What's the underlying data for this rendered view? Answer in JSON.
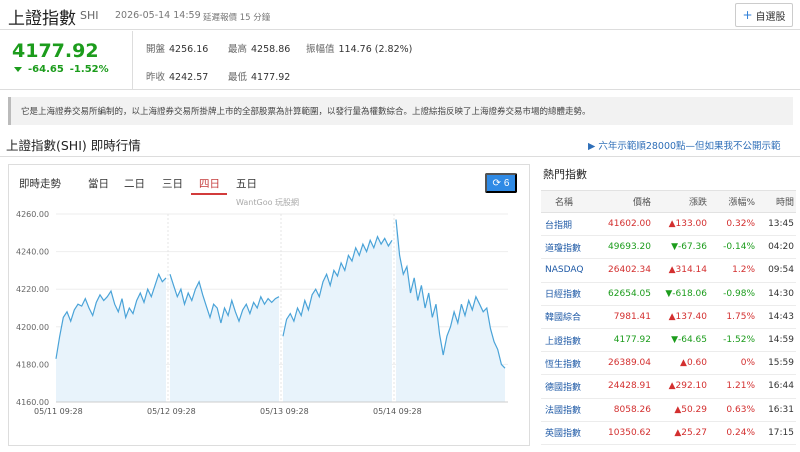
{
  "header": {
    "title": "上證指數",
    "code": "SHI",
    "time": "2026-05-14 14:59",
    "delay_note": "延遲報價 15 分鐘",
    "add_button": "自選股"
  },
  "quote": {
    "price": "4177.92",
    "change": "-64.65",
    "change_pct": "-1.52%",
    "open_label": "開盤",
    "open": "4256.16",
    "high_label": "最高",
    "high": "4258.86",
    "amplitude_label": "振幅值",
    "amplitude": "114.76 (2.82%)",
    "prev_label": "昨收",
    "prev": "4242.57",
    "low_label": "最低",
    "low": "4177.92",
    "colors": {
      "down": "#1c9c1c",
      "up": "#d32f2f"
    }
  },
  "description": "它是上海證券交易所編制的，以上海證券交易所掛牌上市的全部股票為計算範圍，以發行量為權數綜合。上證綜指反映了上海證券交易市場的總體走勢。",
  "section": {
    "title": "上證指數(SHI) 即時行情",
    "news_link": "▶ 六年示範順28000點—但如果我不公開示範"
  },
  "chart_panel": {
    "label": "即時走勢",
    "tabs": [
      "當日",
      "二日",
      "三日",
      "四日",
      "五日"
    ],
    "active_tab": "四日",
    "refresh_label": "6",
    "watermark": "WantGoo 玩股網"
  },
  "chart_data": {
    "type": "line",
    "y_ticks": [
      "4260.00",
      "4240.00",
      "4220.00",
      "4200.00",
      "4180.00",
      "4160.00"
    ],
    "ylim": [
      4160,
      4260
    ],
    "x_labels": [
      "05/11 09:28",
      "05/12 09:28",
      "05/13 09:28",
      "05/14 09:28"
    ],
    "days": [
      {
        "values": [
          4183,
          4195,
          4205,
          4208,
          4203,
          4209,
          4212,
          4211,
          4215,
          4210,
          4206,
          4213,
          4217,
          4214,
          4216,
          4219,
          4212,
          4208,
          4215,
          4205,
          4210,
          4207,
          4214,
          4218,
          4213,
          4220,
          4216,
          4222,
          4228,
          4224,
          4226
        ]
      },
      {
        "values": [
          4228,
          4222,
          4216,
          4220,
          4212,
          4218,
          4214,
          4220,
          4224,
          4217,
          4211,
          4205,
          4212,
          4210,
          4202,
          4210,
          4206,
          4214,
          4208,
          4203,
          4209,
          4212,
          4207,
          4213,
          4210,
          4216,
          4212,
          4215,
          4213,
          4215,
          4216
        ]
      },
      {
        "values": [
          4195,
          4204,
          4207,
          4203,
          4210,
          4206,
          4214,
          4209,
          4217,
          4220,
          4216,
          4224,
          4228,
          4222,
          4230,
          4227,
          4234,
          4230,
          4238,
          4235,
          4242,
          4238,
          4244,
          4240,
          4246,
          4242,
          4248,
          4244,
          4247,
          4243,
          4246
        ]
      },
      {
        "values": [
          4257,
          4238,
          4228,
          4232,
          4218,
          4226,
          4214,
          4222,
          4210,
          4218,
          4205,
          4212,
          4196,
          4185,
          4195,
          4200,
          4208,
          4202,
          4212,
          4206,
          4214,
          4209,
          4216,
          4212,
          4208,
          4210,
          4199,
          4192,
          4188,
          4180,
          4178
        ]
      }
    ],
    "line_color": "#4aa3d8",
    "fill_color": "#e8f3fb",
    "grid": true
  },
  "hot": {
    "title": "熱門指數",
    "headers": [
      "名稱",
      "價格",
      "漲跌",
      "漲幅%",
      "時間"
    ],
    "rows": [
      {
        "name": "台指期",
        "price": "41602.00",
        "chg": "▲133.00",
        "pct": "0.32%",
        "time": "13:45",
        "dir": "up"
      },
      {
        "name": "道瓊指數",
        "price": "49693.20",
        "chg": "▼-67.36",
        "pct": "-0.14%",
        "time": "04:20",
        "dir": "down"
      },
      {
        "name": "NASDAQ",
        "price": "26402.34",
        "chg": "▲314.14",
        "pct": "1.2%",
        "time": "09:54",
        "dir": "up"
      },
      {
        "name": "日經指數",
        "price": "62654.05",
        "chg": "▼-618.06",
        "pct": "-0.98%",
        "time": "14:30",
        "dir": "down"
      },
      {
        "name": "韓國綜合",
        "price": "7981.41",
        "chg": "▲137.40",
        "pct": "1.75%",
        "time": "14:43",
        "dir": "up"
      },
      {
        "name": "上證指數",
        "price": "4177.92",
        "chg": "▼-64.65",
        "pct": "-1.52%",
        "time": "14:59",
        "dir": "down"
      },
      {
        "name": "恆生指數",
        "price": "26389.04",
        "chg": "▲0.60",
        "pct": "0%",
        "time": "15:59",
        "dir": "up"
      },
      {
        "name": "德國指數",
        "price": "24428.91",
        "chg": "▲292.10",
        "pct": "1.21%",
        "time": "16:44",
        "dir": "up"
      },
      {
        "name": "法國指數",
        "price": "8058.26",
        "chg": "▲50.29",
        "pct": "0.63%",
        "time": "16:31",
        "dir": "up"
      },
      {
        "name": "英國指數",
        "price": "10350.62",
        "chg": "▲25.27",
        "pct": "0.24%",
        "time": "17:15",
        "dir": "up"
      }
    ]
  }
}
